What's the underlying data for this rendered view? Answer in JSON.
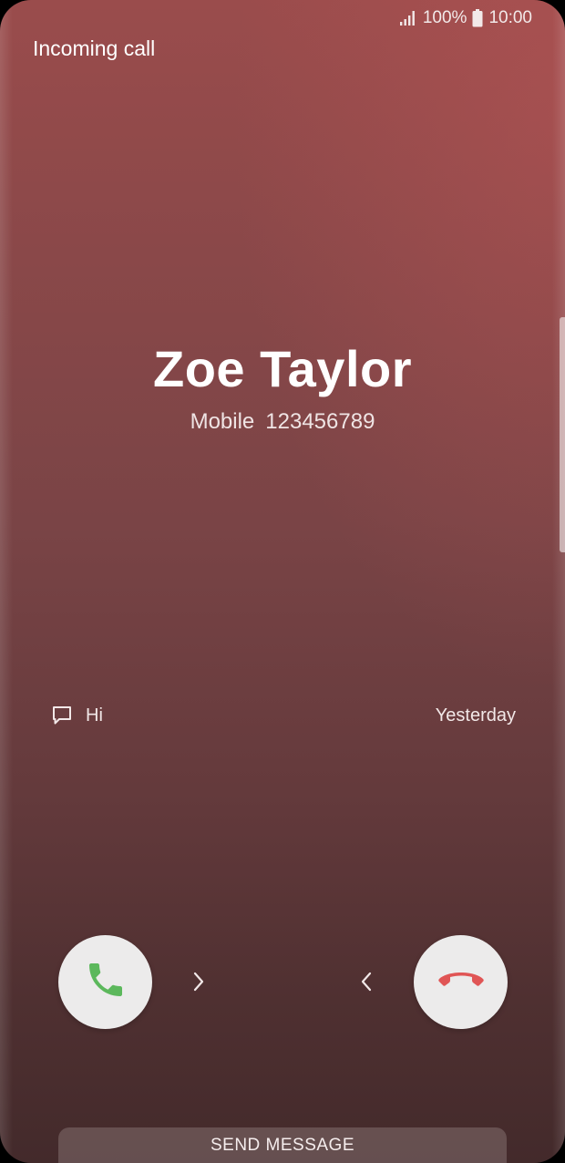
{
  "status_bar": {
    "signal_icon": "signal-icon",
    "battery_percent": "100%",
    "battery_icon": "battery-icon",
    "time": "10:00"
  },
  "screen": {
    "header": "Incoming call"
  },
  "caller": {
    "name": "Zoe Taylor",
    "number_type": "Mobile",
    "number": "123456789"
  },
  "last_message": {
    "icon": "message-bubble-icon",
    "text": "Hi",
    "time": "Yesterday"
  },
  "actions": {
    "accept_icon": "phone-accept-icon",
    "decline_icon": "phone-decline-icon",
    "accept_color": "#5cb85c",
    "decline_color": "#e05555",
    "send_message_label": "SEND MESSAGE"
  }
}
